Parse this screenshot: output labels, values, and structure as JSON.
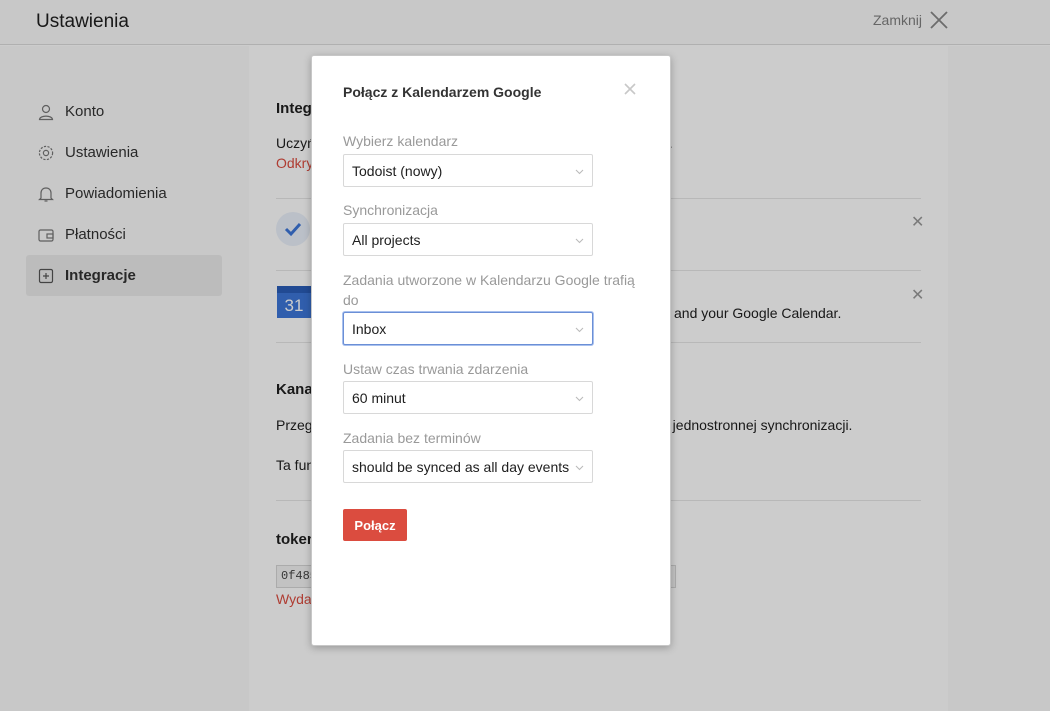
{
  "header": {
    "title": "Ustawienia",
    "close_label": "Zamknij"
  },
  "sidebar": {
    "items": [
      {
        "label": "Konto",
        "icon": "user-icon"
      },
      {
        "label": "Ustawienia",
        "icon": "gear-icon"
      },
      {
        "label": "Powiadomienia",
        "icon": "bell-icon"
      },
      {
        "label": "Płatności",
        "icon": "wallet-icon"
      },
      {
        "label": "Integracje",
        "icon": "integrations-icon",
        "active": true
      }
    ]
  },
  "content": {
    "integrations_heading": "Integ",
    "intro_text_start": "Uczyń",
    "intro_text_end": "e.",
    "intro_link": "Odkry",
    "gcal_desc_end": "and your Google Calendar.",
    "calendar_icon_day": "31",
    "channels_heading": "Kana",
    "channels_text_start": "Przeg",
    "channels_text_end": "ą jednostronnej synchronizacji.",
    "feature_text": "Ta fun",
    "token_heading": "token",
    "token_value": "0f485",
    "token_link": "Wydaj"
  },
  "modal": {
    "title": "Połącz z Kalendarzem Google",
    "fields": [
      {
        "label": "Wybierz kalendarz",
        "value": "Todoist (nowy)"
      },
      {
        "label": "Synchronizacja",
        "value": "All projects"
      },
      {
        "label": "Zadania utworzone w Kalendarzu Google trafią do",
        "value": "Inbox",
        "focused": true
      },
      {
        "label": "Ustaw czas trwania zdarzenia",
        "value": "60 minut"
      },
      {
        "label": "Zadania bez terminów",
        "value": "should be synced as all day events"
      }
    ],
    "submit_label": "Połącz"
  },
  "colors": {
    "accent": "#db4c3f",
    "focus_border": "#6b8fd6",
    "overlay": "rgba(0,0,0,0.2)"
  }
}
